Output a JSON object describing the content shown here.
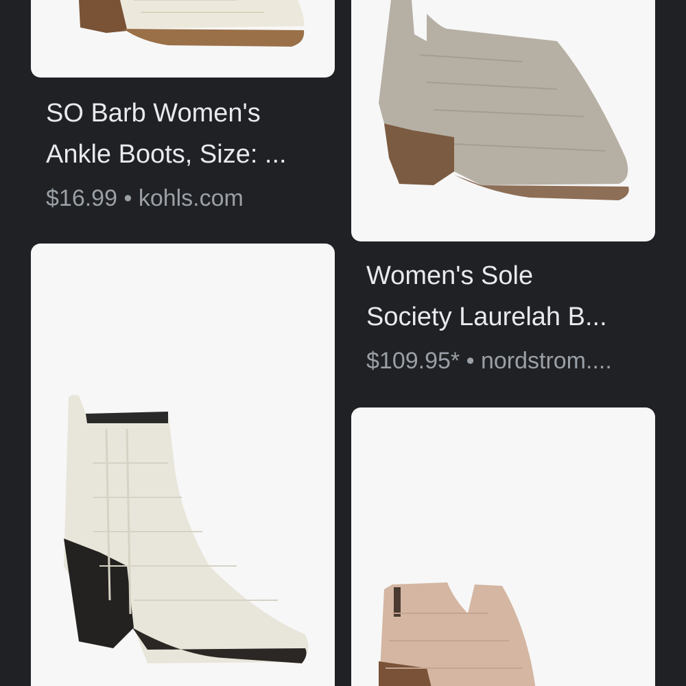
{
  "results": [
    {
      "title_line1": "SO Barb Women's",
      "title_line2": "Ankle Boots, Size: ...",
      "price": "$16.99",
      "separator": "•",
      "source": "kohls.com",
      "image_icon": "white-croc-boot-icon"
    },
    {
      "title_line1": "Women's Sole",
      "title_line2": "Society Laurelah B...",
      "price": "$109.95*",
      "separator": "•",
      "source": "nordstrom....",
      "image_icon": "grey-croc-bootie-icon"
    },
    {
      "image_icon": "white-croc-chelsea-boot-icon"
    },
    {
      "image_icon": "blush-croc-bootie-icon"
    }
  ],
  "colors": {
    "background": "#202124",
    "card": "#f7f7f7",
    "title_text": "#e8eaed",
    "meta_text": "#9aa0a6"
  }
}
